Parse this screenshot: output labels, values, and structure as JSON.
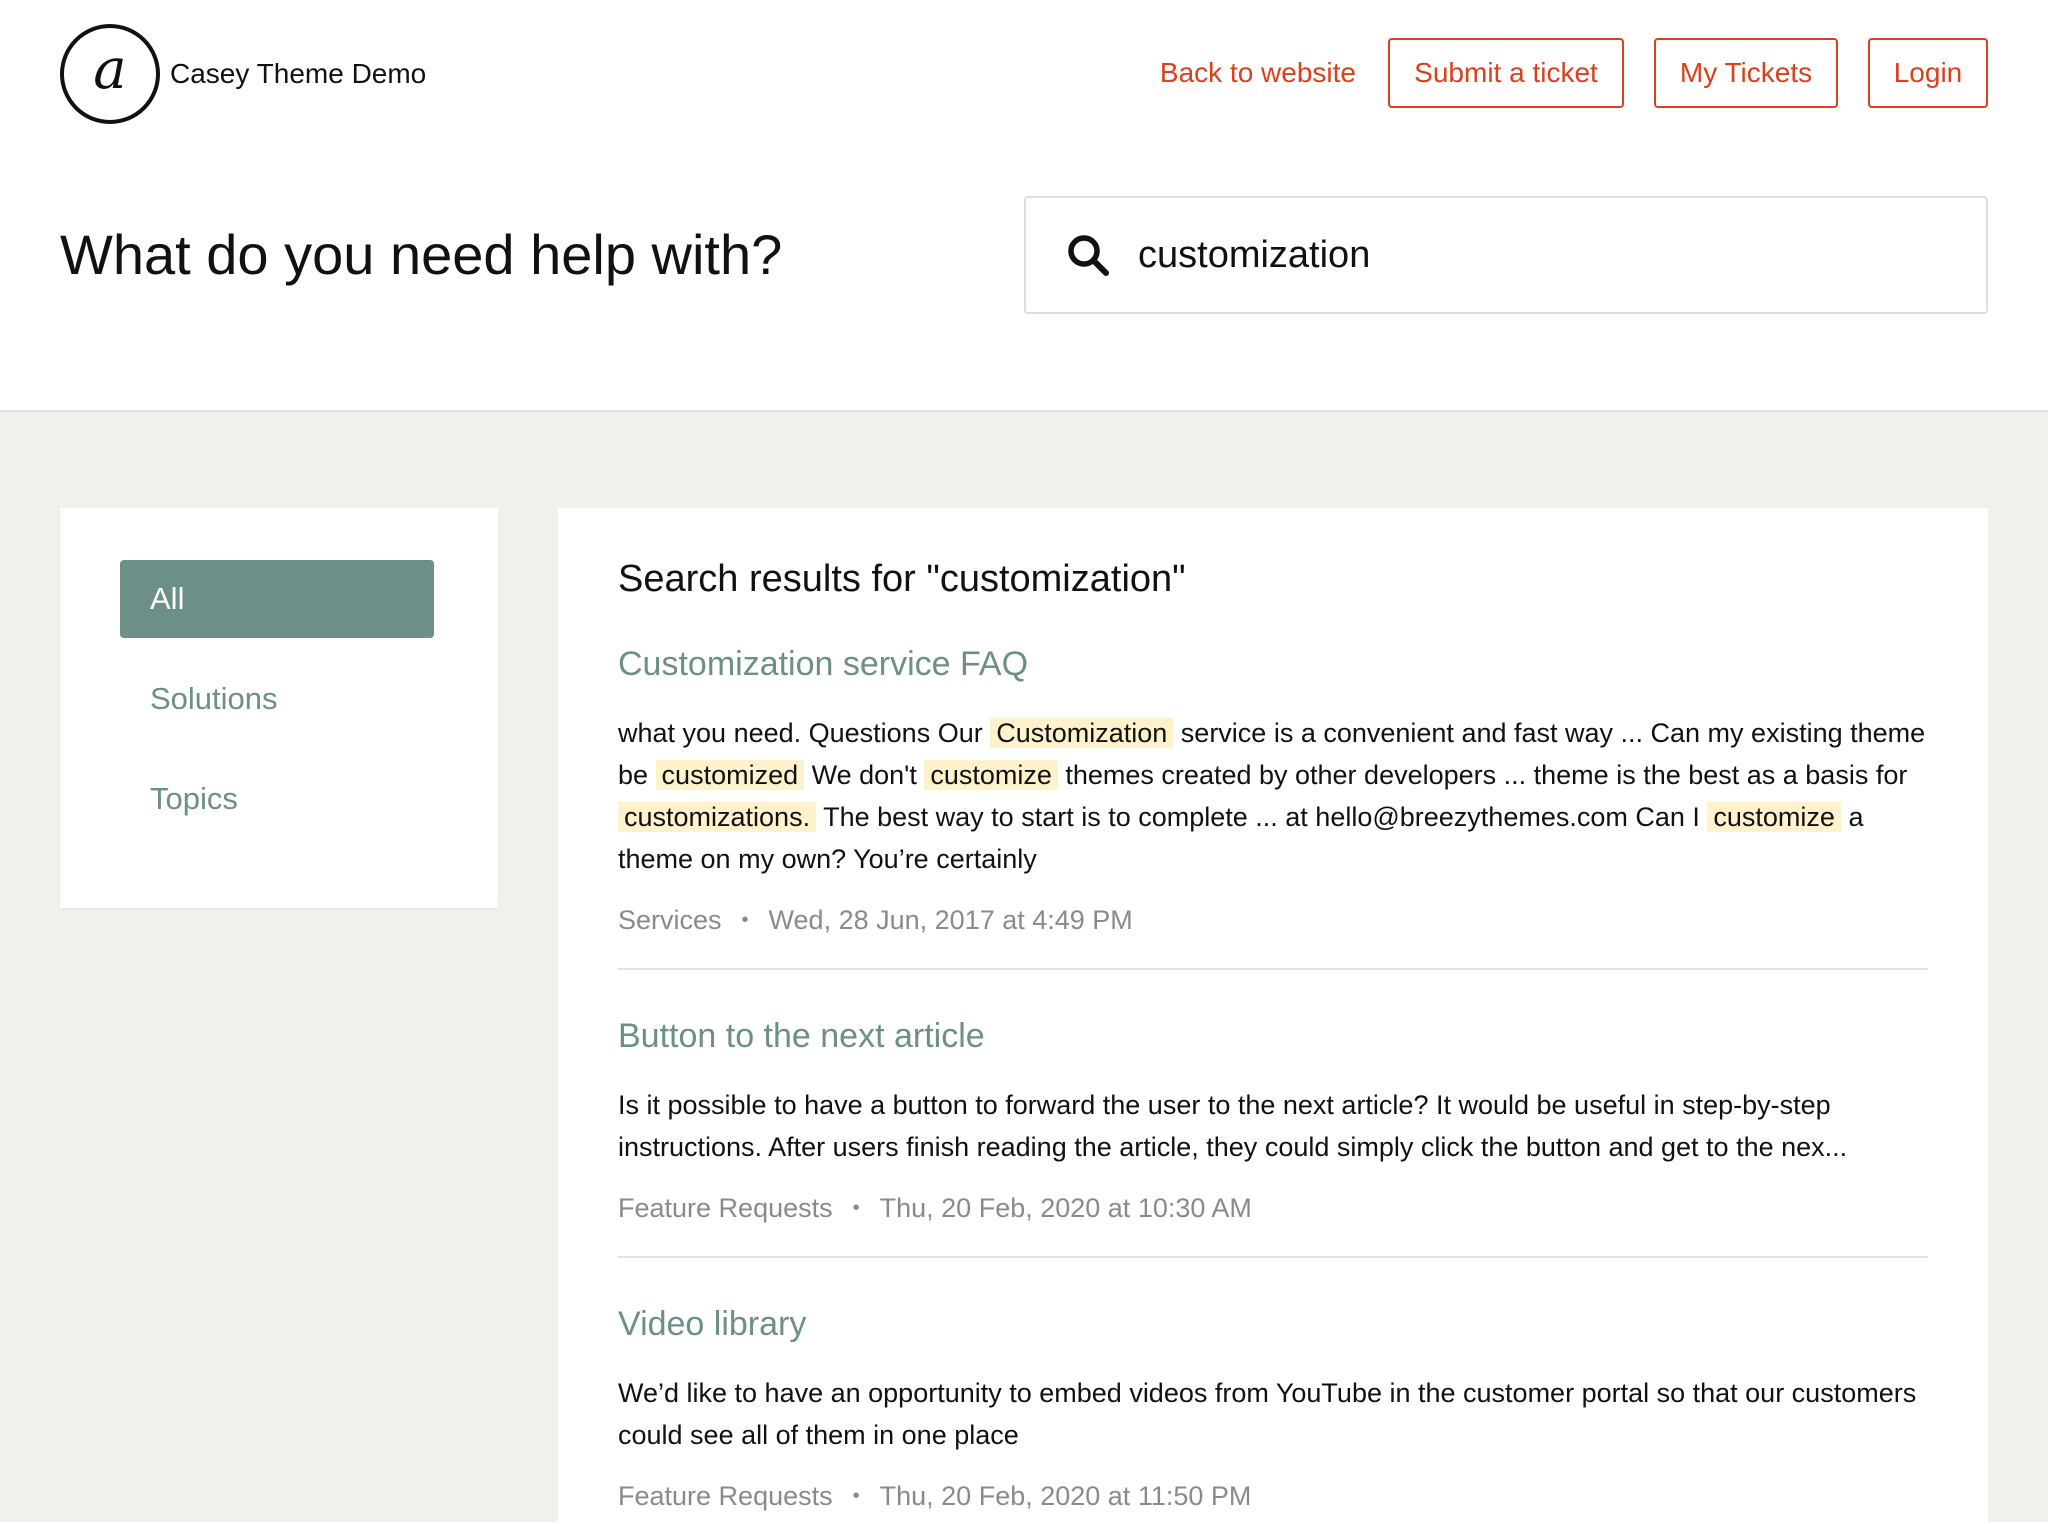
{
  "brand": {
    "logo_glyph": "a",
    "name": "Casey Theme Demo"
  },
  "nav": {
    "back": "Back to website",
    "submit": "Submit a ticket",
    "my_tickets": "My Tickets",
    "login": "Login"
  },
  "hero": {
    "title": "What do you need help with?"
  },
  "search": {
    "value": "customization",
    "icon": "search-icon"
  },
  "filters": [
    {
      "label": "All",
      "active": true
    },
    {
      "label": "Solutions",
      "active": false
    },
    {
      "label": "Topics",
      "active": false
    }
  ],
  "results": {
    "title": "Search results for \"customization\"",
    "items": [
      {
        "title": "Customization service FAQ",
        "snippet_parts": [
          {
            "text": "what you need.  Questions Our ",
            "hl": false
          },
          {
            "text": "Customization",
            "hl": true
          },
          {
            "text": " service is a convenient and fast way ... Can my existing theme be ",
            "hl": false
          },
          {
            "text": "customized",
            "hl": true
          },
          {
            "text": " We don't ",
            "hl": false
          },
          {
            "text": "customize",
            "hl": true
          },
          {
            "text": " themes created by other developers ... theme is the best as a basis for ",
            "hl": false
          },
          {
            "text": "customizations.",
            "hl": true
          },
          {
            "text": " The best way to start is to complete ... at hello@breezythemes.com Can I ",
            "hl": false
          },
          {
            "text": "customize",
            "hl": true
          },
          {
            "text": " a theme on my own? You’re certainly",
            "hl": false
          }
        ],
        "category": "Services",
        "date": "Wed, 28 Jun, 2017 at 4:49 PM"
      },
      {
        "title": "Button to the next article",
        "snippet_parts": [
          {
            "text": "Is it possible to have a button to forward the user to the next article? It would be useful in step-by-step instructions. After users finish reading the article, they could simply click the button and get to the nex...",
            "hl": false
          }
        ],
        "category": "Feature Requests",
        "date": "Thu, 20 Feb, 2020 at 10:30 AM"
      },
      {
        "title": "Video library",
        "snippet_parts": [
          {
            "text": "We’d like to have an opportunity to embed videos from YouTube in the customer portal so that our customers could see all of them in one place",
            "hl": false
          }
        ],
        "category": "Feature Requests",
        "date": "Thu, 20 Feb, 2020 at 11:50 PM"
      }
    ]
  },
  "meta_separator": "•",
  "colors": {
    "accent_red": "#d9411e",
    "accent_green": "#6c8f88",
    "highlight": "#fdf2cc",
    "background_gray": "#f1f0eb"
  }
}
